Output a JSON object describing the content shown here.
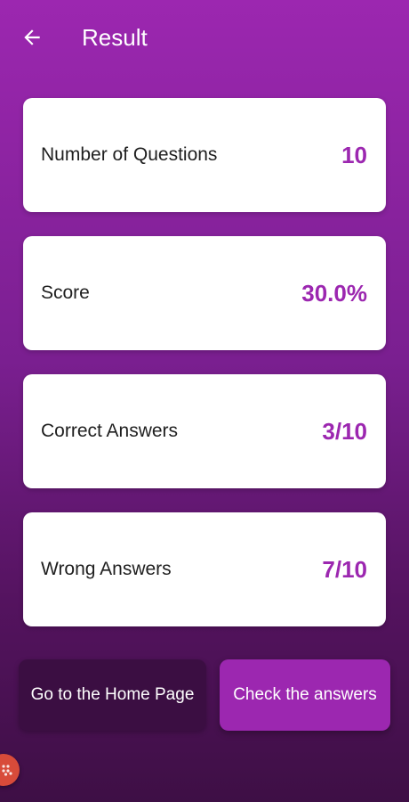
{
  "appbar": {
    "title": "Result",
    "back_icon": "arrow-left-icon"
  },
  "cards": [
    {
      "label": "Number of Questions",
      "value": "10"
    },
    {
      "label": "Score",
      "value": "30.0%"
    },
    {
      "label": "Correct Answers",
      "value": "3/10"
    },
    {
      "label": "Wrong Answers",
      "value": "7/10"
    }
  ],
  "buttons": {
    "home_label": "Go to the Home Page",
    "check_label": "Check the answers"
  },
  "colors": {
    "accent": "#9c27b0",
    "dark_button": "#3b0e42",
    "fab": "#d84b3a"
  },
  "fab_icon": "grid-dots-icon"
}
